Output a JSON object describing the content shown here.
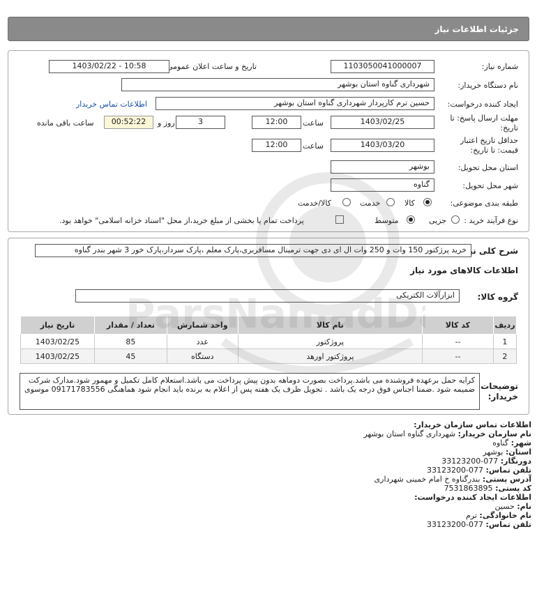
{
  "header": {
    "title": "جزئیات اطلاعات نیاز"
  },
  "form": {
    "need_number_label": "شماره نیاز:",
    "need_number": "1103050041000007",
    "announce_label": "تاریخ و ساعت اعلان عمومی:",
    "announce_value": "1403/02/22 - 10:58",
    "buyer_org_label": "نام دستگاه خریدار:",
    "buyer_org": "شهرداری گناوه استان بوشهر",
    "creator_label": "ایجاد کننده درخواست:",
    "creator": "حسین ترم کارپرداز شهرداری گناوه استان بوشهر",
    "contact_link": "اطلاعات تماس خریدار",
    "deadline_label_1": "مهلت ارسال پاسخ: تا",
    "deadline_label_2": "تاریخ:",
    "deadline_date": "1403/02/25",
    "time_label": "ساعت",
    "deadline_time": "12:00",
    "days": "3",
    "days_label": "روز و",
    "remaining": "00:52:22",
    "remaining_label": "ساعت باقی مانده",
    "validity_label_1": "حداقل تاریخ اعتبار",
    "validity_label_2": "قیمت: تا تاریخ:",
    "validity_date": "1403/03/20",
    "validity_time": "12:00",
    "province_label": "استان محل تحویل:",
    "province": "بوشهر",
    "city_label": "شهر محل تحویل:",
    "city": "گناوه",
    "category_label": "طبقه بندی موضوعی:",
    "category_options": [
      "کالا",
      "خدمت",
      "کالا/خدمت"
    ],
    "process_label": "نوع فرآیند خرید :",
    "process_options": [
      "جزیی",
      "متوسط"
    ],
    "payment_note": "پرداخت تمام یا بخشی از مبلغ خرید،از محل \"اسناد خزانه اسلامی\" خواهد بود."
  },
  "need": {
    "summary_label": "شرح کلی نیاز:",
    "summary": "خرید پرژکتور 150 وات و 250 وات ال ای دی جهت ترمینال مسافربری،پارک معلم ،پارک سردار،پارک خور 3 شهر بندر گناوه",
    "goods_section": "اطلاعات کالاهای مورد نیاز",
    "group_label": "گروه کالا:",
    "group": "ابزارآلات الکتریکی"
  },
  "table": {
    "headers": [
      "ردیف",
      "کد کالا",
      "نام کالا",
      "واحد شمارش",
      "تعداد / مقدار",
      "تاریخ نیاز"
    ],
    "rows": [
      {
        "idx": "1",
        "code": "--",
        "name": "پروژکتور",
        "unit": "عدد",
        "qty": "85",
        "date": "1403/02/25"
      },
      {
        "idx": "2",
        "code": "--",
        "name": "پروژکتور اورهد",
        "unit": "دستگاه",
        "qty": "45",
        "date": "1403/02/25"
      }
    ]
  },
  "notes": {
    "label_1": "توضیحات",
    "label_2": "خریدار:",
    "text": "کرایه حمل برعهده فروشنده می باشد.پرداخت بصورت دوماهه بدون پیش پرداخت می باشد.استعلام کامل تکمیل و مهمور شود.مدارک شرکت ضمیمه شود .ضمنا اجناس فوق درجه یک باشد . تحویل ظرف یک هفته پس از اعلام به برنده باید انجام شود هماهنگی 09171783556 موسوی"
  },
  "contact": {
    "buyer_title": "اطلاعات تماس سازمان خریدار:",
    "org_label": "نام سازمان خریدار:",
    "org": "شهرداری گناوه استان بوشهر",
    "city_label": "شهر:",
    "city": "گناوه",
    "province_label": "استان:",
    "province": "بوشهر",
    "fax_label": "دورنگار:",
    "fax": "077-33123200",
    "phone_label": "تلفن تماس:",
    "phone": "077-33123200",
    "address_label": "آدرس پستی:",
    "address": "بندرگناوه خ امام خمینی شهرداری",
    "postal_label": "کد پستی:",
    "postal": "7531863895",
    "creator_title": "اطلاعات ایجاد کننده درخواست:",
    "name_label": "نام:",
    "name": "حسین",
    "family_label": "نام خانوادگی:",
    "family": "ترم",
    "creator_phone_label": "تلفن تماس:",
    "creator_phone": "077-33123200"
  },
  "watermark": {
    "brand": "ParsNamadData"
  },
  "colors": {
    "header_bg": "#8a8a8a",
    "timer_bg": "#fcf7d9",
    "link": "#1a4ea8",
    "table_header": "#d0d0d0"
  }
}
